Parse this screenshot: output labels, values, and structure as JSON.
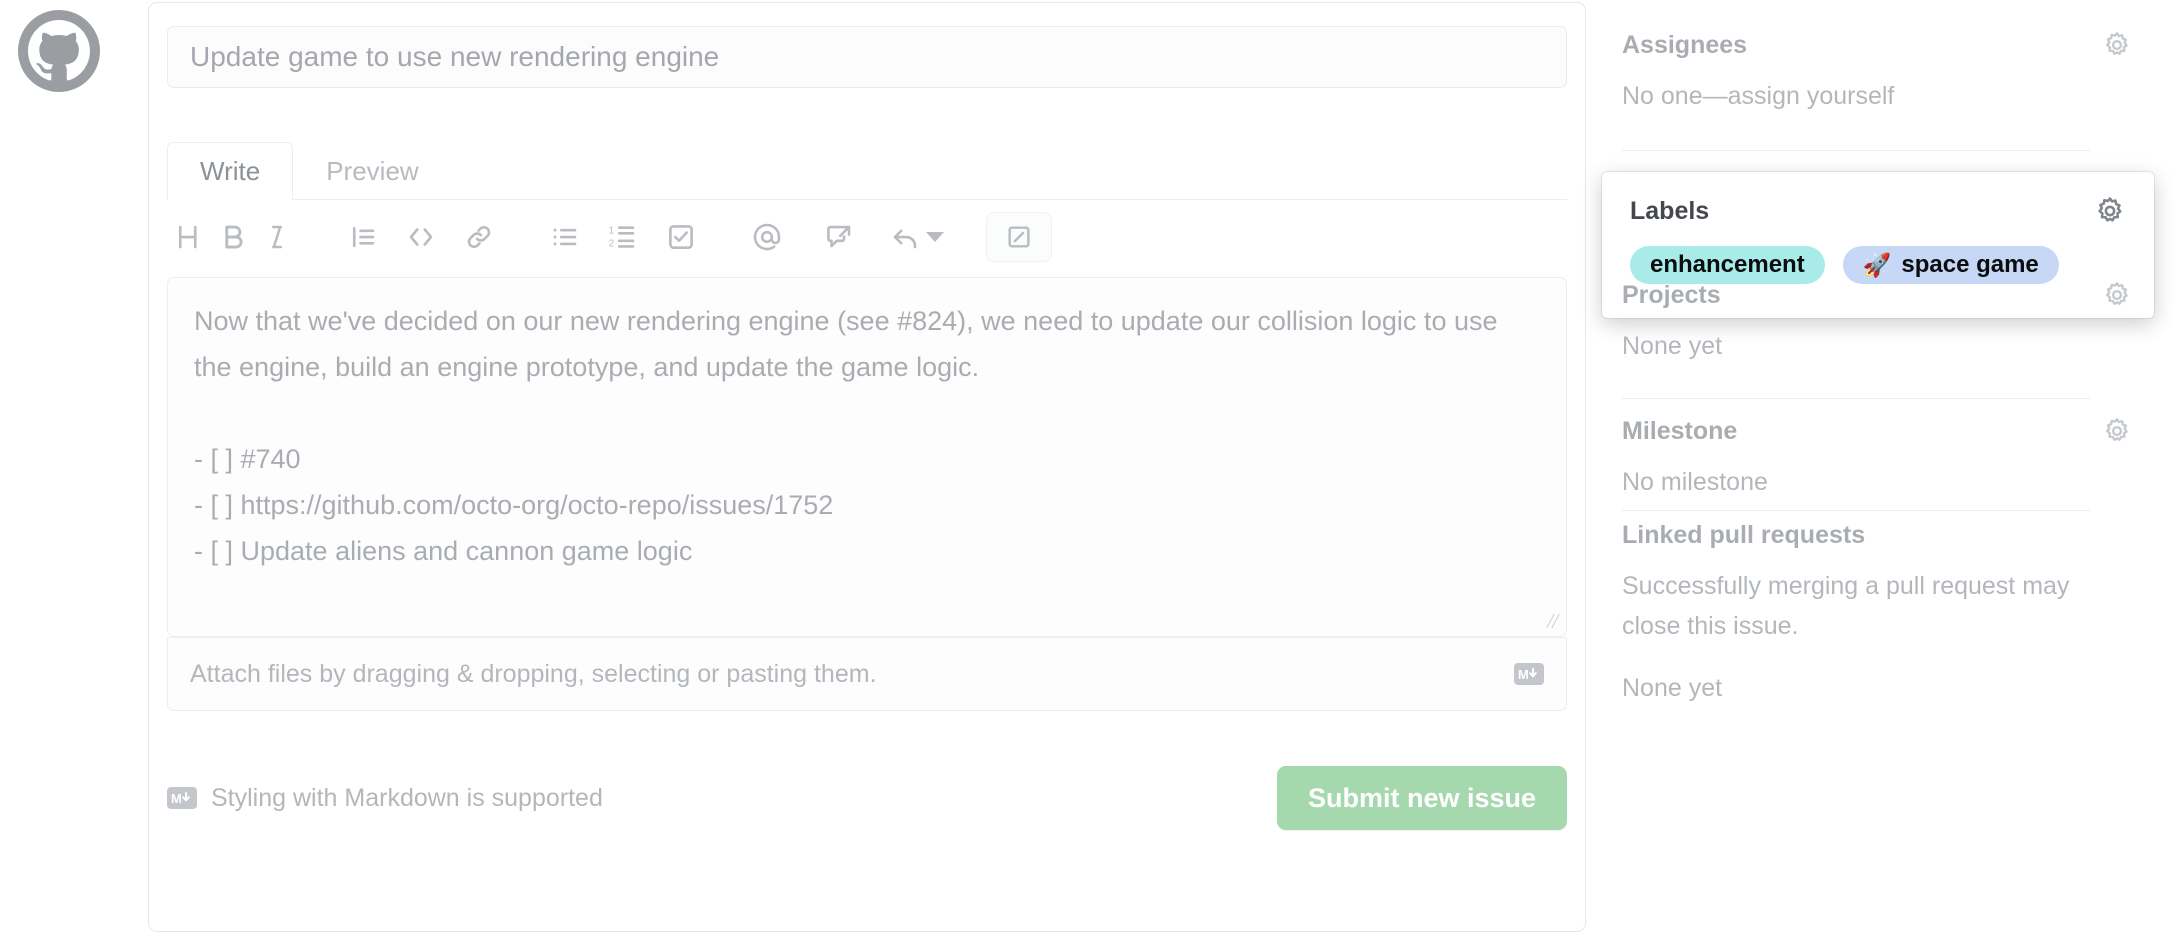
{
  "avatar": {
    "icon": "github-octocat-icon",
    "alt": "GitHub avatar"
  },
  "issue_form": {
    "title_field": {
      "value": "Update game to use new rendering engine",
      "placeholder": "Title"
    },
    "tabs": [
      {
        "label": "Write",
        "active": true
      },
      {
        "label": "Preview",
        "active": false
      }
    ],
    "toolbar": [
      {
        "name": "heading-icon",
        "title": "Add heading text"
      },
      {
        "name": "bold-icon",
        "title": "Add bold text"
      },
      {
        "name": "italic-icon",
        "title": "Add italic text"
      },
      {
        "name": "quote-icon",
        "title": "Insert a quote"
      },
      {
        "name": "code-icon",
        "title": "Insert code"
      },
      {
        "name": "link-icon",
        "title": "Add a link"
      },
      {
        "name": "unordered-list-icon",
        "title": "Add a bulleted list"
      },
      {
        "name": "ordered-list-icon",
        "title": "Add a numbered list"
      },
      {
        "name": "task-list-icon",
        "title": "Add a task list"
      },
      {
        "name": "mention-icon",
        "title": "Directly mention a user or team"
      },
      {
        "name": "cross-reference-icon",
        "title": "Reference an issue, pull request, or discussion"
      },
      {
        "name": "saved-reply-icon",
        "title": "Add saved reply"
      },
      {
        "name": "markdown-preview-toggle-icon",
        "title": "Markdown editor toggle"
      }
    ],
    "body_field": {
      "value": "Now that we've decided on our new rendering engine (see #824), we need to update our collision logic to use the engine, build an engine prototype, and update the game logic.\n\n- [ ] #740\n- [ ] https://github.com/octo-org/octo-repo/issues/1752\n- [ ] Update aliens and cannon game logic",
      "placeholder": "Leave a comment"
    },
    "attach_hint": "Attach files by dragging & dropping, selecting or pasting them.",
    "attach_icon": "markdown-icon",
    "markdown_support": {
      "icon": "markdown-icon",
      "text": "Styling with Markdown is supported"
    },
    "submit_label": "Submit new issue",
    "submit_color": "#a6d8ae"
  },
  "sidebar": {
    "sections": [
      {
        "name": "assignees",
        "title": "Assignees",
        "body": "No one—assign yourself",
        "gear": true,
        "highlighted": false
      },
      {
        "name": "labels",
        "title": "Labels",
        "body": "",
        "gear": true,
        "highlighted": true,
        "labels": [
          {
            "text": "enhancement",
            "emoji": "",
            "color": "#a9ebe8"
          },
          {
            "text": "space game",
            "emoji": "🚀",
            "color": "#c6d8f5"
          }
        ]
      },
      {
        "name": "projects",
        "title": "Projects",
        "body": "None yet",
        "gear": true,
        "highlighted": false
      },
      {
        "name": "milestone",
        "title": "Milestone",
        "body": "No milestone",
        "gear": true,
        "highlighted": false
      },
      {
        "name": "linked-pull-requests",
        "title": "Linked pull requests",
        "body": "Successfully merging a pull request may close this issue.",
        "body2": "None yet",
        "gear": false,
        "highlighted": false
      }
    ]
  }
}
